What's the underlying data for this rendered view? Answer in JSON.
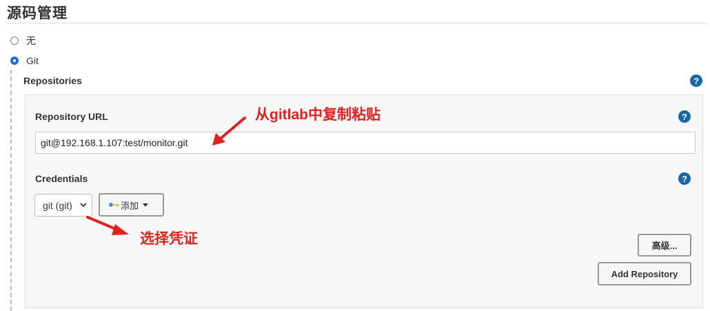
{
  "section": {
    "title": "源码管理"
  },
  "scm": {
    "options": [
      {
        "label": "无",
        "checked": false
      },
      {
        "label": "Git",
        "checked": true
      }
    ]
  },
  "repositories": {
    "label": "Repositories",
    "url_label": "Repository URL",
    "url_value": "git@192.168.1.107:test/monitor.git",
    "credentials_label": "Credentials",
    "credentials_selected": "git (git)",
    "add_label": "添加",
    "advanced_label": "高级...",
    "add_repository_label": "Add Repository",
    "help_glyph": "?"
  },
  "annotations": {
    "copy_from_gitlab": "从gitlab中复制粘贴",
    "choose_credential": "选择凭证"
  },
  "colors": {
    "help": "#1568a8",
    "annotation": "#e3211c",
    "radio_checked": "#1a6fdb"
  },
  "icons": [
    "help-icon",
    "key-icon",
    "caret-down-icon",
    "select-chevron-icon",
    "red-arrow"
  ]
}
